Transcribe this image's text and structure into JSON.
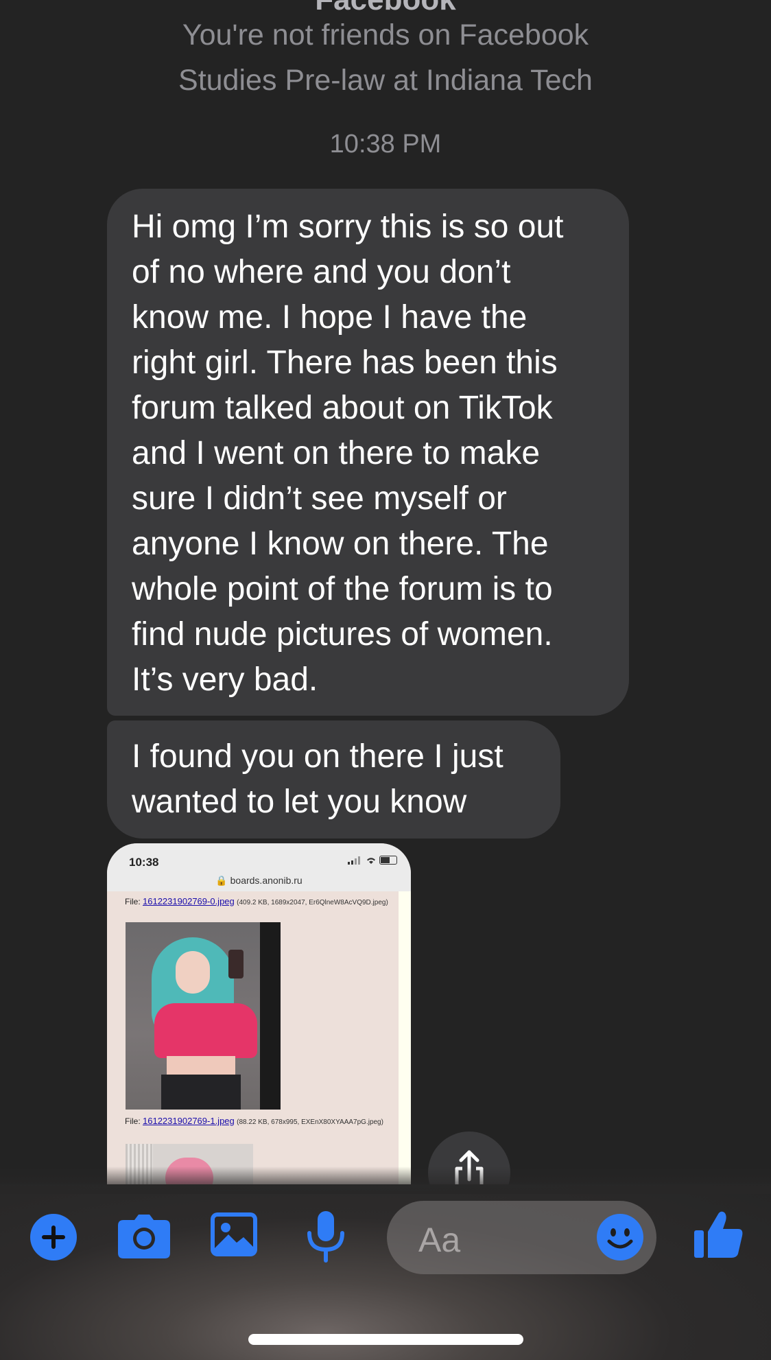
{
  "header": {
    "title": "Facebook",
    "friend_status": "You're not friends on Facebook",
    "studies": "Studies Pre-law at Indiana Tech"
  },
  "thread": {
    "timestamp": "10:38 PM",
    "messages": [
      {
        "lines": [
          "Hi omg I’m sorry this is so out",
          "of no where and you don’t",
          "know me. I hope I have the",
          "right girl. There has been this",
          "forum talked about on TikTok",
          "and I went on there to make",
          "sure I didn’t see myself or",
          "anyone I know on there. The",
          "whole point of the forum is to",
          "find nude pictures of women.",
          "It’s very bad."
        ]
      },
      {
        "lines": [
          "I found you on there I just",
          "wanted to let you know"
        ]
      }
    ],
    "attachment": {
      "status_time": "10:38",
      "url": "boards.anonib.ru",
      "file1_prefix": "File: ",
      "file1_link": "1612231902769-0.jpeg",
      "file1_meta": "(409.2 KB, 1689x2047, Er6QlneW8AcVQ9D.jpeg)",
      "file2_prefix": "File: ",
      "file2_link": "1612231902769-1.jpeg",
      "file2_meta": "(88.22 KB, 678x995, EXEnX80XYAAA7pG.jpeg)"
    }
  },
  "composer": {
    "placeholder": "Aa",
    "icons": [
      "plus-icon",
      "camera-icon",
      "gallery-icon",
      "microphone-icon",
      "emoji-icon",
      "thumbs-up-icon",
      "share-icon"
    ],
    "accent_color": "#2f7cf6"
  }
}
